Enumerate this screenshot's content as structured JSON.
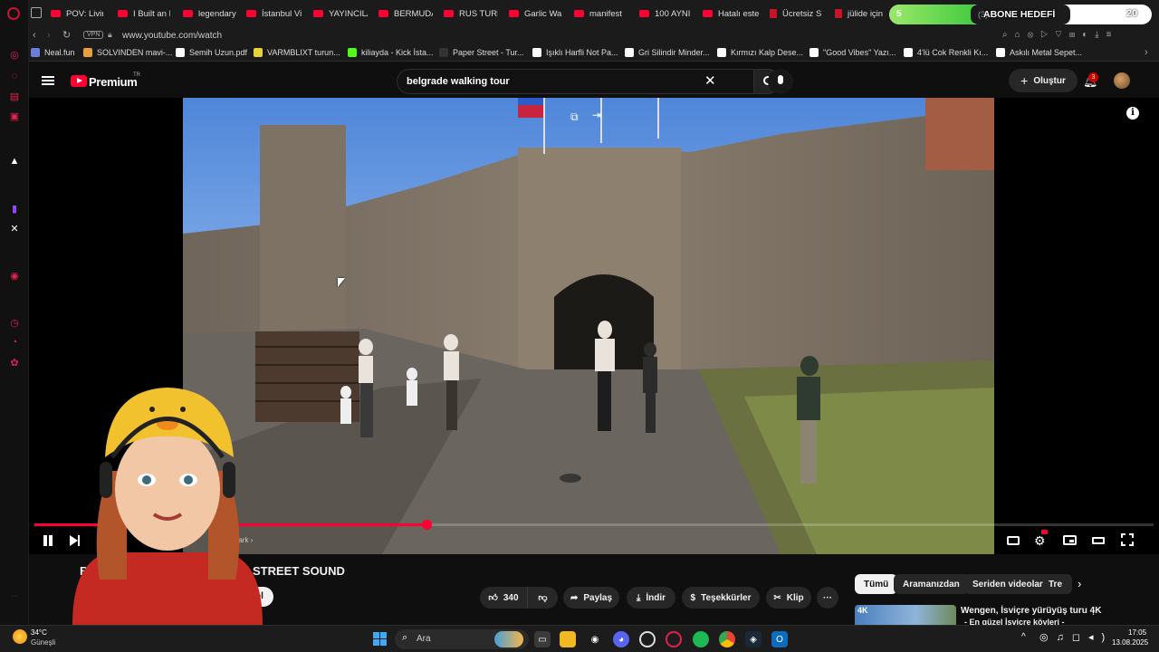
{
  "browser": {
    "tabs": [
      {
        "label": "POV: Living"
      },
      {
        "label": "I Built an E"
      },
      {
        "label": "legendary"
      },
      {
        "label": "İstanbul Vi"
      },
      {
        "label": "YAYINCILA"
      },
      {
        "label": "BERMUDA"
      },
      {
        "label": "RUS TURI"
      },
      {
        "label": "Garlic Wa"
      },
      {
        "label": "manifest"
      },
      {
        "label": "100 AYNI"
      },
      {
        "label": "Hatalı este"
      },
      {
        "label": "Ücretsiz S"
      },
      {
        "label": "jülide için"
      },
      {
        "label": "(3)"
      }
    ],
    "url": "www.youtube.com/watch",
    "vpn_label": "VPN",
    "overlay_badge": {
      "label": "ABONE HEDEFİ",
      "count": "20",
      "progress": 0.35
    },
    "bookmarks": [
      {
        "label": "Neal.fun"
      },
      {
        "label": "SOLVINDEN mavi-..."
      },
      {
        "label": "Semih Uzun.pdf"
      },
      {
        "label": "VARMBLIXT turun..."
      },
      {
        "label": "kiliayda - Kick İsta..."
      },
      {
        "label": "Paper Street - Tur..."
      },
      {
        "label": "Işıklı Harfli Not Pa..."
      },
      {
        "label": "Gri Silindir Minder..."
      },
      {
        "label": "Kırmızı Kalp Dese..."
      },
      {
        "label": "\"Good Vibes\" Yazı..."
      },
      {
        "label": "4'lü Cok Renkli Kı..."
      },
      {
        "label": "Askılı Metal Sepet..."
      }
    ]
  },
  "youtube": {
    "logo_text": "Premium",
    "logo_superscript": "TR",
    "search_value": "belgrade walking tour",
    "create_label": "Oluştur",
    "notification_count": "3"
  },
  "player": {
    "progress": 0.35,
    "chapter_label": "Park",
    "title_left": "BE",
    "title_right": "K STREET SOUND",
    "subscribe_fragment": "ol"
  },
  "actions": {
    "like_count": "340",
    "share_label": "Paylaş",
    "download_label": "İndir",
    "thanks_label": "Teşekkürler",
    "clip_label": "Klip"
  },
  "chips": [
    {
      "label": "Tümü",
      "active": true
    },
    {
      "label": "Aramanızdan",
      "active": false
    },
    {
      "label": "Seriden videolar",
      "active": false
    },
    {
      "label": "Tre",
      "active": false
    }
  ],
  "recommendation": {
    "title": "Wengen, İsviçre yürüyüş turu 4K",
    "subtitle": "- En güzel İsviçre köyleri -",
    "thumb_badge": "4K"
  },
  "taskbar": {
    "weather_temp": "34°C",
    "weather_label": "Güneşli",
    "search_label": "Ara",
    "time": "17:05",
    "date": "13.08.2025"
  }
}
